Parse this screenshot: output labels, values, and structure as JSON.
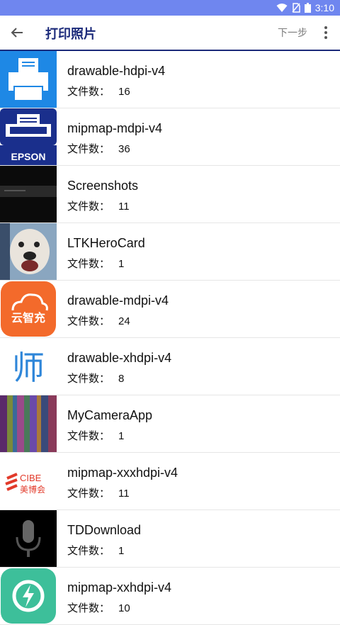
{
  "status_bar": {
    "time": "3:10",
    "icons": [
      "wifi-icon",
      "no-sim-icon",
      "battery-icon"
    ]
  },
  "toolbar": {
    "title": "打印照片",
    "next_label": "下一步",
    "back_icon": "arrow-left-icon",
    "more_icon": "more-vertical-icon"
  },
  "count_label": "文件数：",
  "folders": [
    {
      "name": "drawable-hdpi-v4",
      "count": "16",
      "thumb": "printer-thumb"
    },
    {
      "name": "mipmap-mdpi-v4",
      "count": "36",
      "thumb": "epson-thumb"
    },
    {
      "name": "Screenshots",
      "count": "11",
      "thumb": "screenshot-thumb"
    },
    {
      "name": "LTKHeroCard",
      "count": "1",
      "thumb": "dog-photo-thumb"
    },
    {
      "name": "drawable-mdpi-v4",
      "count": "24",
      "thumb": "cloud-logo-thumb"
    },
    {
      "name": "drawable-xhdpi-v4",
      "count": "8",
      "thumb": "shi-logo-thumb"
    },
    {
      "name": "MyCameraApp",
      "count": "1",
      "thumb": "glitch-photo-thumb"
    },
    {
      "name": "mipmap-xxxhdpi-v4",
      "count": "11",
      "thumb": "cibe-logo-thumb"
    },
    {
      "name": "TDDownload",
      "count": "1",
      "thumb": "microphone-thumb"
    },
    {
      "name": "mipmap-xxhdpi-v4",
      "count": "10",
      "thumb": "lightning-logo-thumb"
    }
  ],
  "thumb_text": {
    "epson": "EPSON",
    "cloud": "云智充",
    "shi": "师",
    "cibe_top": "CIBE",
    "cibe_bottom": "美博会"
  },
  "colors": {
    "status_bar": "#6f86ef",
    "title": "#1b2a7a",
    "accent_blue": "#1e88e5"
  }
}
